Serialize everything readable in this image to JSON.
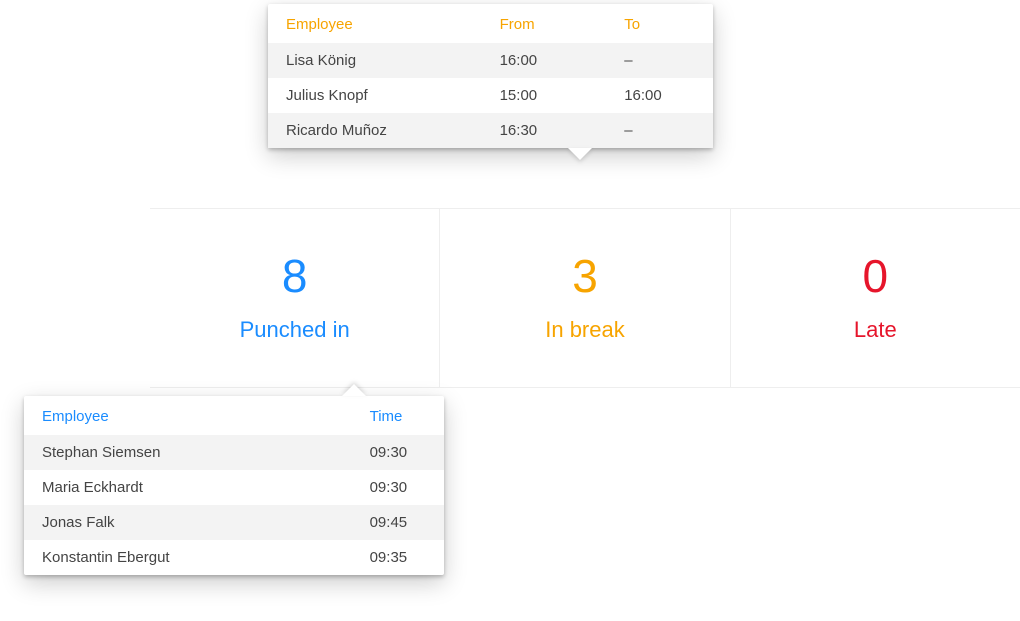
{
  "cards": {
    "punched_in": {
      "count": "8",
      "label": "Punched in"
    },
    "in_break": {
      "count": "3",
      "label": "In break"
    },
    "late": {
      "count": "0",
      "label": "Late"
    }
  },
  "break_popover": {
    "headers": {
      "employee": "Employee",
      "from": "From",
      "to": "To"
    },
    "rows": [
      {
        "employee": "Lisa König",
        "from": "16:00",
        "to": "–"
      },
      {
        "employee": "Julius Knopf",
        "from": "15:00",
        "to": "16:00"
      },
      {
        "employee": "Ricardo Muñoz",
        "from": "16:30",
        "to": "–"
      }
    ]
  },
  "punched_popover": {
    "headers": {
      "employee": "Employee",
      "time": "Time"
    },
    "rows": [
      {
        "employee": "Stephan Siemsen",
        "time": "09:30"
      },
      {
        "employee": "Maria Eckhardt",
        "time": "09:30"
      },
      {
        "employee": "Jonas Falk",
        "time": "09:45"
      },
      {
        "employee": "Konstantin Ebergut",
        "time": "09:35"
      }
    ]
  }
}
